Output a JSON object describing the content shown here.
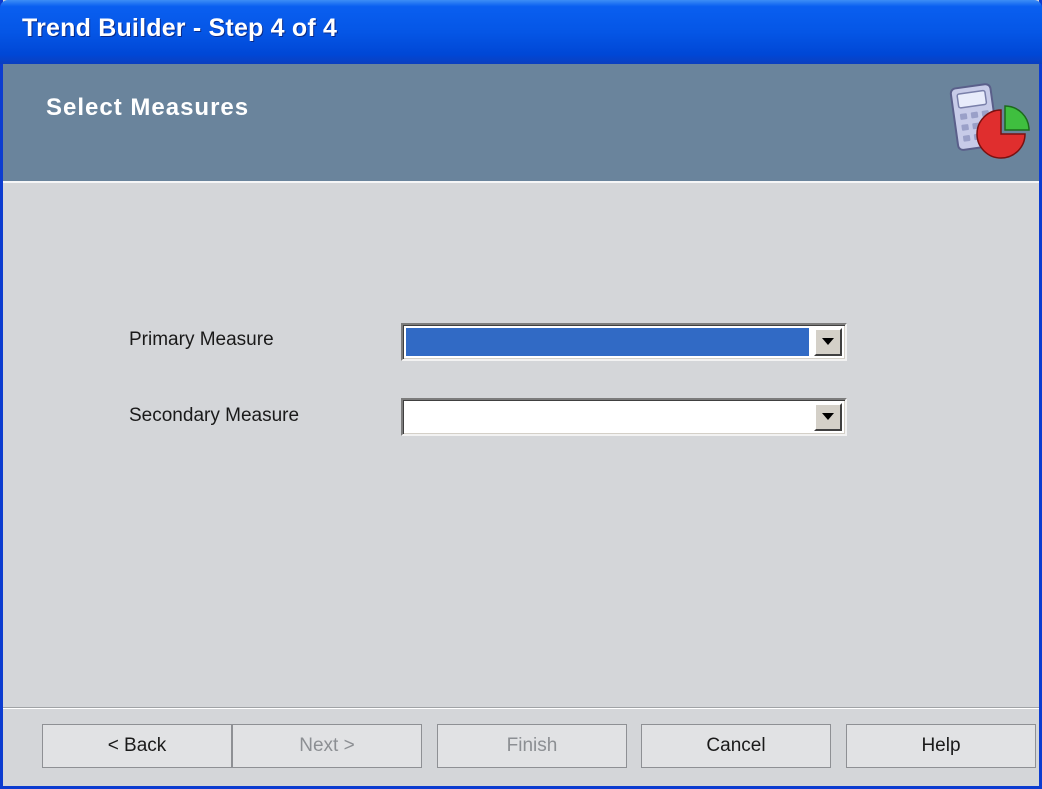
{
  "window": {
    "title": "Trend Builder - Step 4 of 4"
  },
  "header": {
    "title": "Select Measures",
    "icon": "calculator-pie-chart-icon"
  },
  "form": {
    "primary": {
      "label": "Primary Measure",
      "value": "",
      "selected": true
    },
    "secondary": {
      "label": "Secondary Measure",
      "value": ""
    }
  },
  "buttons": {
    "back": {
      "label": "< Back",
      "enabled": true
    },
    "next": {
      "label": "Next >",
      "enabled": false
    },
    "finish": {
      "label": "Finish",
      "enabled": false
    },
    "cancel": {
      "label": "Cancel",
      "enabled": true
    },
    "help": {
      "label": "Help",
      "enabled": true
    }
  },
  "colors": {
    "title_bar": "#0556e6",
    "header_band": "#6a849c",
    "body": "#d4d6d9",
    "selection": "#316ac5"
  }
}
